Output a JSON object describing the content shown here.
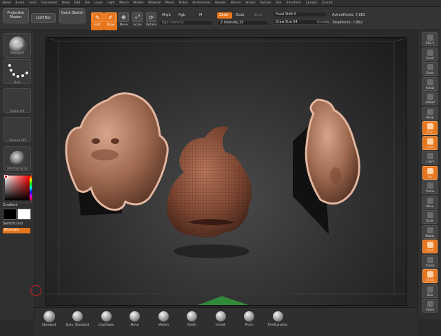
{
  "menu": [
    "Alpha",
    "Brush",
    "Color",
    "Document",
    "Draw",
    "Edit",
    "File",
    "Layer",
    "Light",
    "Macro",
    "Marker",
    "Material",
    "Movie",
    "Picker",
    "Preferences",
    "Render",
    "Stencil",
    "Stroke",
    "Texture",
    "Tool",
    "Transform",
    "Zplugin",
    "Zscript"
  ],
  "shelf": {
    "projection_master": "Projection Master",
    "lightbox": "LightBox",
    "quick_sketch": "Quick Sketch",
    "tools": [
      {
        "label": "Edit",
        "icon": "edit-icon",
        "active": true
      },
      {
        "label": "Draw",
        "icon": "draw-icon",
        "active": true
      },
      {
        "label": "Move",
        "icon": "move-icon",
        "active": false
      },
      {
        "label": "Scale",
        "icon": "scale-icon",
        "active": false
      },
      {
        "label": "Rotate",
        "icon": "rotate-icon",
        "active": false
      }
    ],
    "mrgb": "Mrgb",
    "rgb": "Rgb",
    "m": "M",
    "rgb_intensity": "Rgb Intensity",
    "zadd": "Zadd",
    "zsub": "Zsub",
    "zcut": "Zcut",
    "z_intensity": "Z Intensity 25",
    "focal_shift": "Focal Shift 0",
    "draw_size": "Draw Size 64",
    "dynamic": "Dynamic",
    "active_points": "ActivePoints: 7,882",
    "total_points": "TotalPoints: 7,882"
  },
  "left_tray": {
    "brush_caption": "Standard",
    "stroke_caption": "Dots",
    "alpha_caption": "Alpha Off",
    "texture_caption": "Texture Off",
    "material_caption": "MatCap Gray",
    "gradient_label": "Gradient",
    "switch_color_label": "SwitchColor",
    "alternate_label": "Alternate",
    "main_color": "#b52020"
  },
  "right_tray": [
    {
      "label": "SPix 3",
      "on": false
    },
    {
      "label": "Scroll",
      "on": false
    },
    {
      "label": "Zoom",
      "on": false
    },
    {
      "label": "Actual",
      "on": false
    },
    {
      "label": "AAHalf",
      "on": false
    },
    {
      "label": "Persp",
      "on": false
    },
    {
      "label": "Floor",
      "on": true
    },
    {
      "label": "Local",
      "on": true
    },
    {
      "label": "L.Sym",
      "on": false
    },
    {
      "label": "Xyz",
      "on": true
    },
    {
      "label": "Frame",
      "on": false
    },
    {
      "label": "Move",
      "on": false
    },
    {
      "label": "Scale",
      "on": false
    },
    {
      "label": "Rotate",
      "on": false
    },
    {
      "label": "PolyF",
      "on": true
    },
    {
      "label": "Transp",
      "on": false
    },
    {
      "label": "Ghost",
      "on": true
    },
    {
      "label": "Solo",
      "on": false
    },
    {
      "label": "Xpose",
      "on": false
    }
  ],
  "bottom_brushes": [
    "Standard",
    "Dam_Standard",
    "ClayTubes",
    "Move",
    "hPolish",
    "Polish",
    "trimAll",
    "Pinch",
    "TrimDynamic"
  ],
  "colors": {
    "accent": "#e8761d",
    "skin": "#b07a5e"
  }
}
